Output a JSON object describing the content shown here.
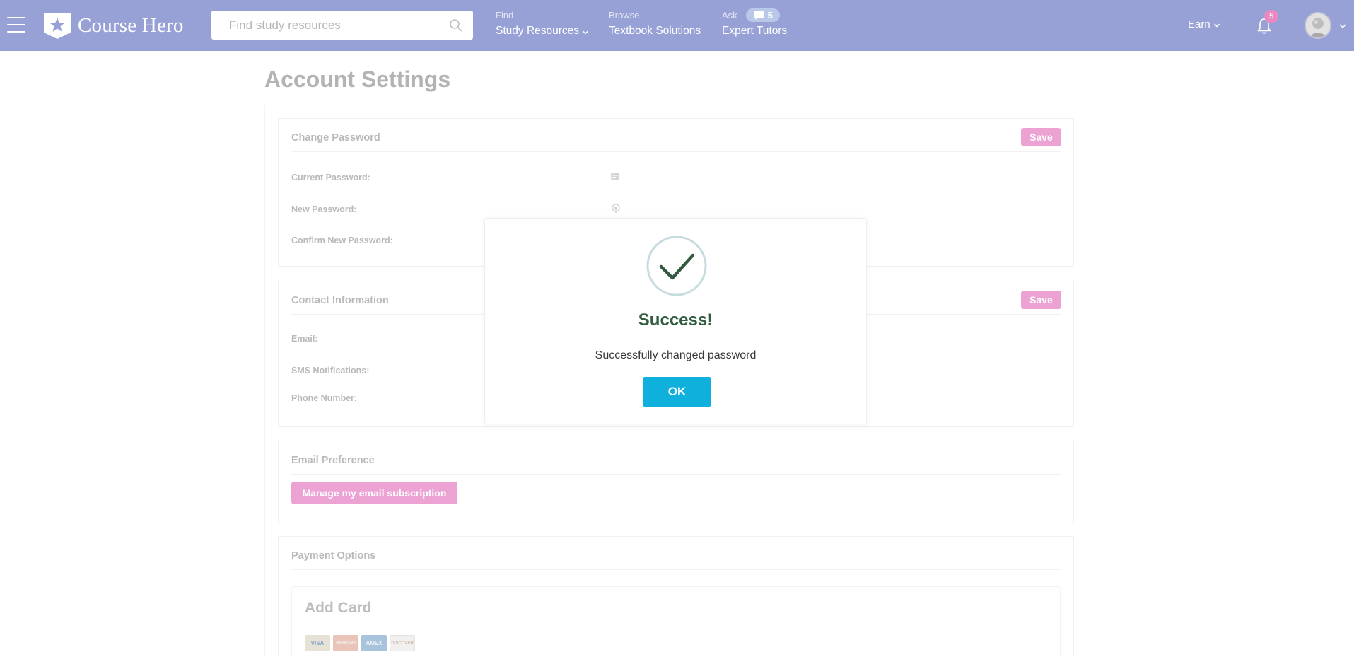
{
  "header": {
    "logo_text": "Course Hero",
    "search_placeholder": "Find study resources",
    "nav": [
      {
        "small": "Find",
        "main": "Study Resources"
      },
      {
        "small": "Browse",
        "main": "Textbook Solutions"
      },
      {
        "small": "Ask",
        "main": "Expert Tutors",
        "badge": "5"
      }
    ],
    "earn_label": "Earn",
    "notification_count": "5",
    "bg_color": "#97a1d5"
  },
  "page": {
    "title": "Account Settings",
    "change_password": {
      "title": "Change Password",
      "save_label": "Save",
      "current_label": "Current Password:",
      "new_label": "New Password:",
      "confirm_label": "Confirm New Password:"
    },
    "contact": {
      "title": "Contact Information",
      "save_label": "Save",
      "email_label": "Email:",
      "sms_label": "SMS Notifications:",
      "phone_label": "Phone Number:"
    },
    "email_pref": {
      "title": "Email Preference",
      "manage_label": "Manage my email subscription"
    },
    "payment": {
      "title": "Payment Options",
      "add_card_title": "Add Card",
      "cards": [
        "VISA",
        "MasterCard",
        "AMEX",
        "DISCOVER"
      ]
    }
  },
  "modal": {
    "title": "Success!",
    "message": "Successfully changed password",
    "ok_label": "OK",
    "accent_color": "#0fb0dc",
    "title_color": "#325c40"
  }
}
